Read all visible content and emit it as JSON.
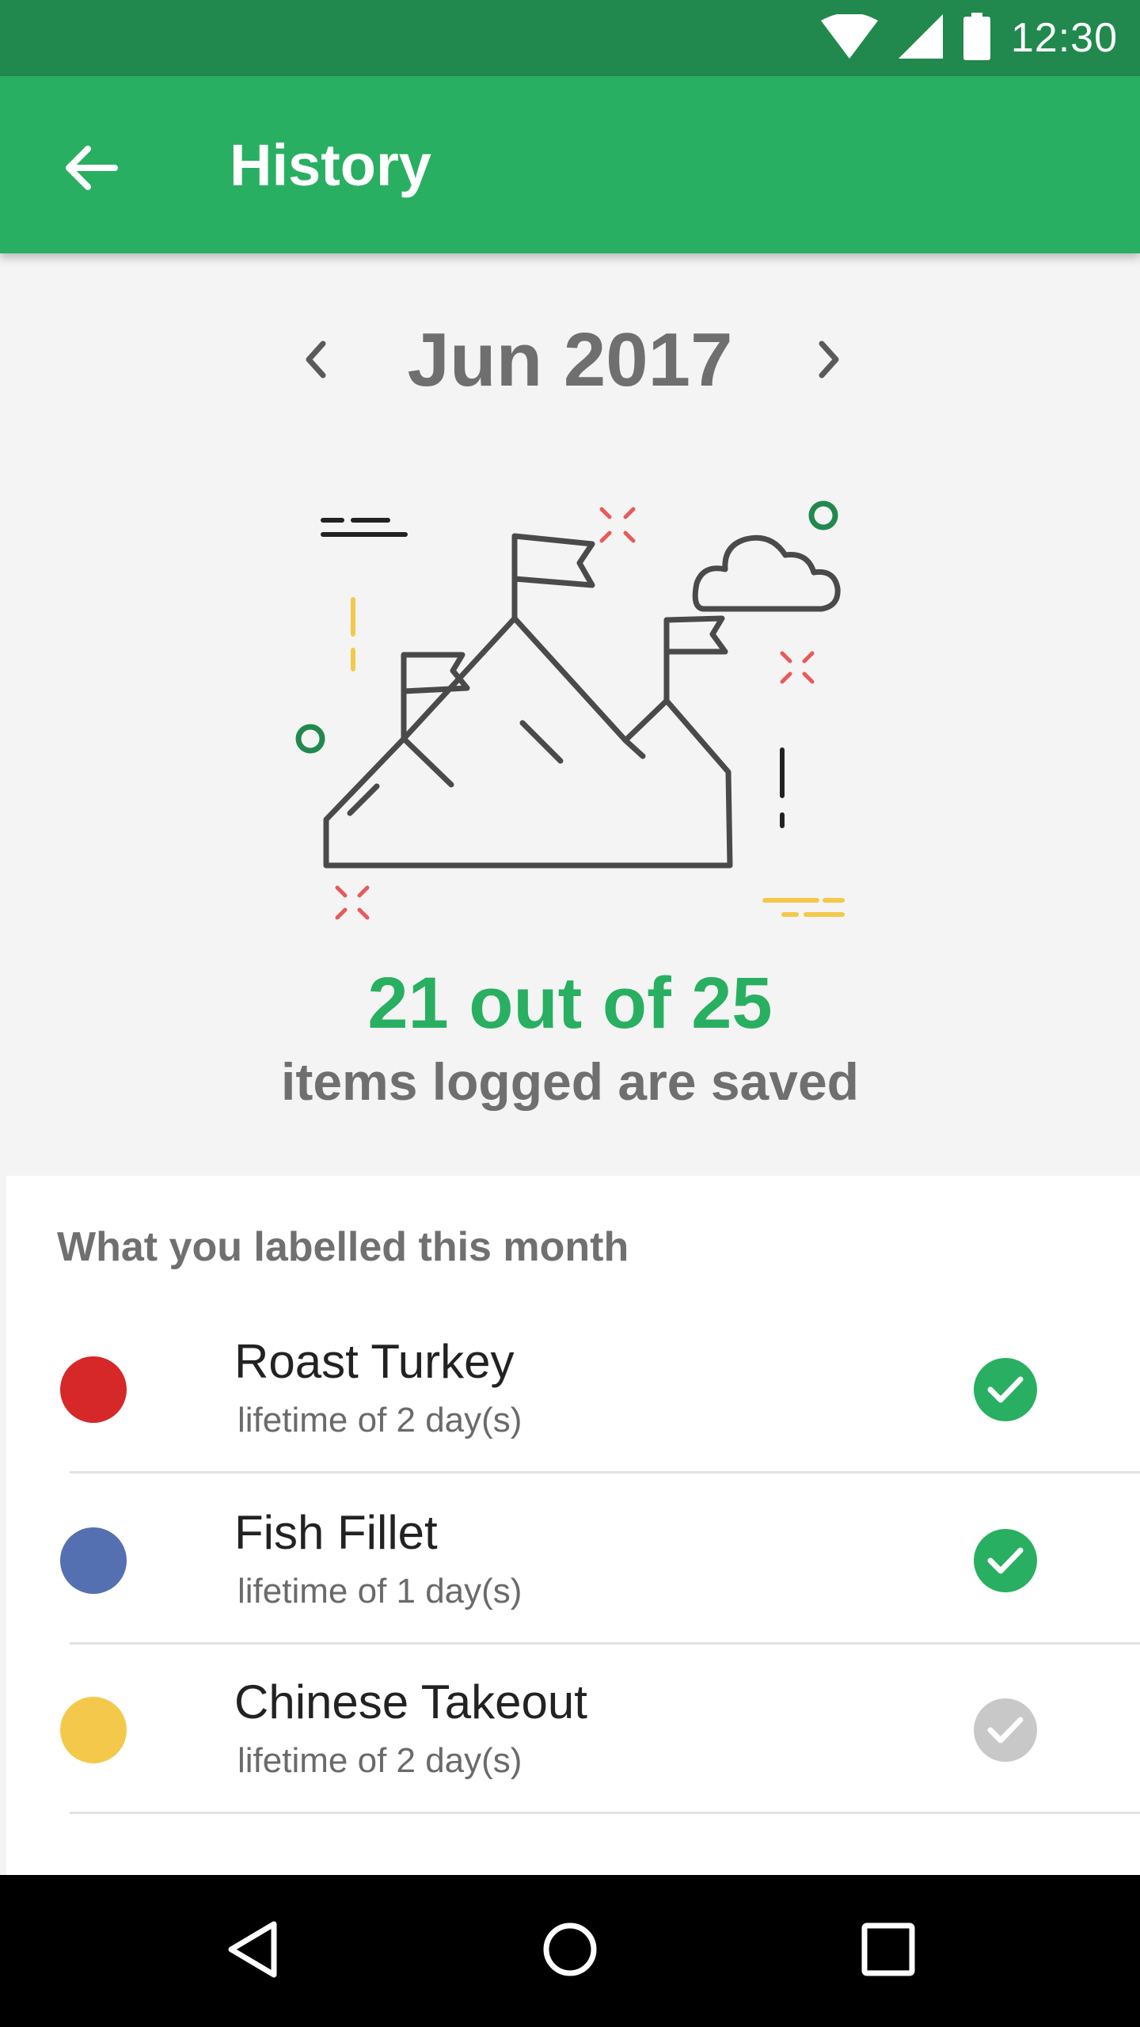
{
  "status_bar": {
    "time": "12:30",
    "icons": [
      "wifi-icon",
      "signal-icon",
      "battery-icon"
    ]
  },
  "app_bar": {
    "title": "History",
    "back_icon": "arrow-left-icon"
  },
  "month_nav": {
    "label": "Jun 2017",
    "prev_icon": "chevron-left-icon",
    "next_icon": "chevron-right-icon"
  },
  "illustration": {
    "icon": "mountain-flags-illustration"
  },
  "summary": {
    "count": "21 out of 25",
    "text": "items logged are saved"
  },
  "list": {
    "title": "What you labelled this month",
    "items": [
      {
        "name": "Roast Turkey",
        "lifetime": "lifetime of 2 day(s)",
        "dot_color": "#d62828",
        "saved": true
      },
      {
        "name": "Fish Fillet",
        "lifetime": "lifetime of 1 day(s)",
        "dot_color": "#5470b0",
        "saved": true
      },
      {
        "name": "Chinese Takeout",
        "lifetime": "lifetime of 2 day(s)",
        "dot_color": "#f4c94b",
        "saved": false
      }
    ]
  },
  "colors": {
    "primary": "#29af61",
    "primary_dark": "#21894d",
    "check_saved": "#29af61",
    "check_unsaved": "#c8c8c8"
  },
  "nav_bar": {
    "icons": [
      "back-triangle-icon",
      "home-circle-icon",
      "recents-square-icon"
    ]
  }
}
